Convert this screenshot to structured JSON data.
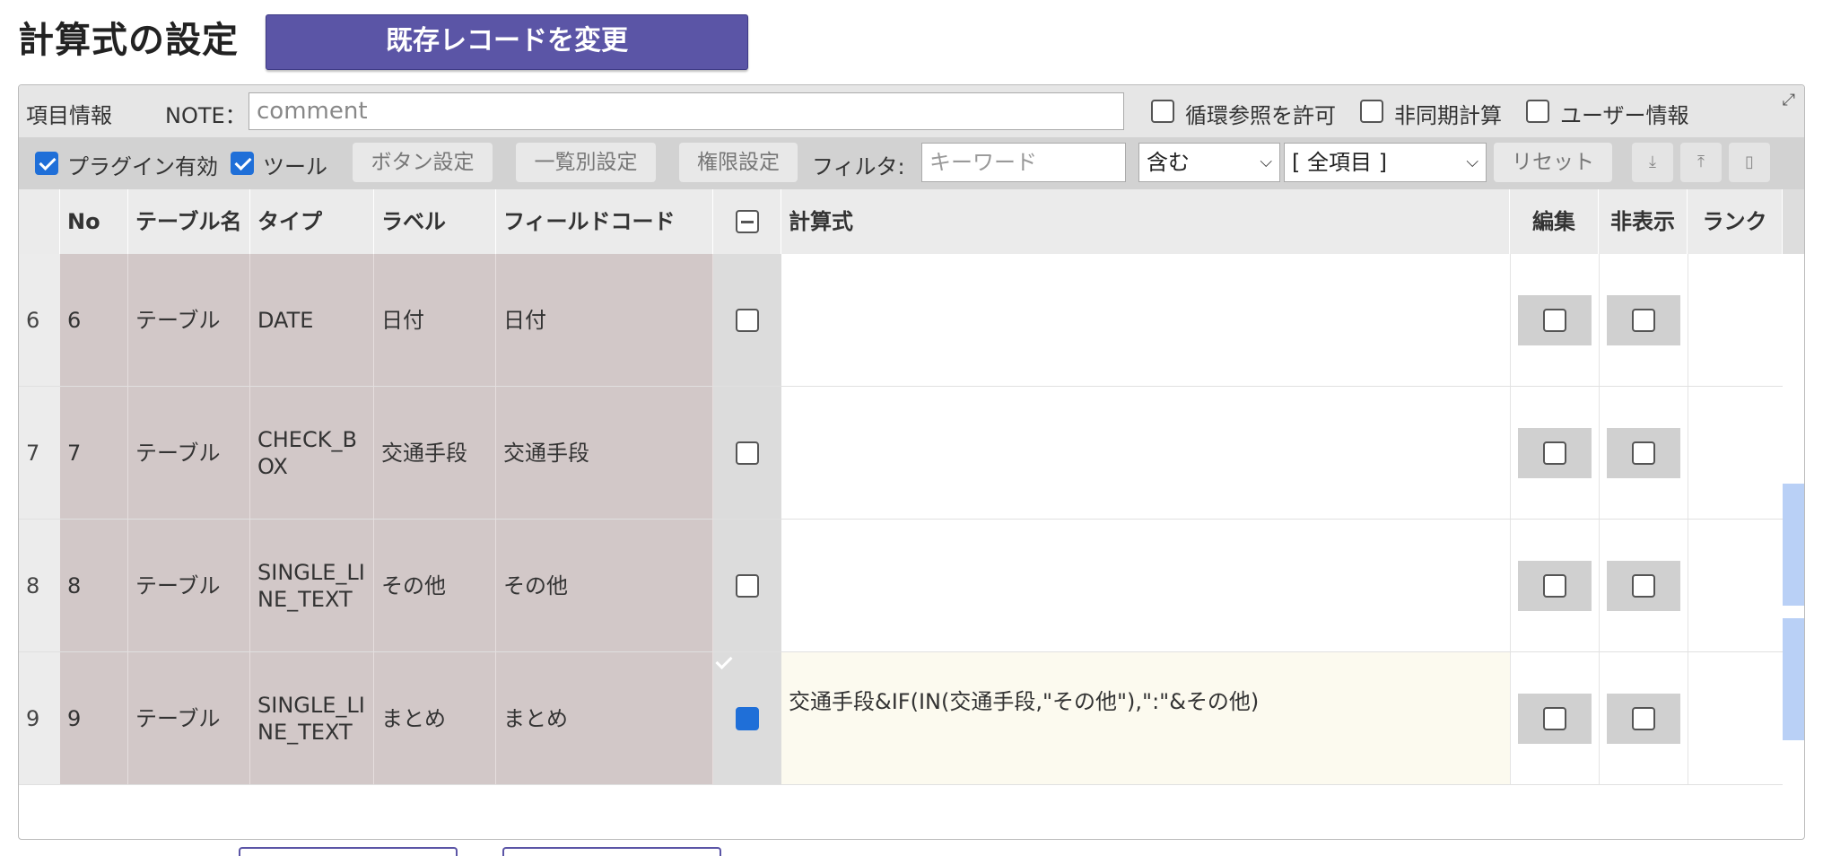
{
  "header": {
    "title": "計算式の設定",
    "change_button": "既存レコードを変更"
  },
  "info_bar": {
    "section_label": "項目情報",
    "note_label": "NOTE：",
    "note_value": "comment",
    "allow_circular_label": "循環参照を許可",
    "async_calc_label": "非同期計算",
    "user_info_label": "ユーザー情報"
  },
  "toolbar": {
    "plugin_enabled_label": "プラグイン有効",
    "plugin_enabled": true,
    "tool_label": "ツール",
    "tool_enabled": true,
    "button_settings": "ボタン設定",
    "list_settings": "一覧別設定",
    "permission_settings": "権限設定",
    "filter_label": "フィルタ:",
    "keyword_placeholder": "キーワード",
    "match_select": "含む",
    "field_select": "[ 全項目 ]",
    "reset_button": "リセット"
  },
  "table": {
    "headers": {
      "no": "No",
      "table_name": "テーブル名",
      "type": "タイプ",
      "label": "ラベル",
      "field_code": "フィールドコード",
      "formula": "計算式",
      "edit": "編集",
      "hidden": "非表示",
      "rank": "ランク"
    },
    "rows": [
      {
        "index": "6",
        "no": "6",
        "table_name": "テーブル",
        "type": "DATE",
        "label": "日付",
        "field_code": "日付",
        "checked": false,
        "formula": "",
        "edit": false,
        "hidden": false,
        "rank": ""
      },
      {
        "index": "7",
        "no": "7",
        "table_name": "テーブル",
        "type": "CHECK_BOX",
        "label": "交通手段",
        "field_code": "交通手段",
        "checked": false,
        "formula": "",
        "edit": false,
        "hidden": false,
        "rank": ""
      },
      {
        "index": "8",
        "no": "8",
        "table_name": "テーブル",
        "type": "SINGLE_LINE_TEXT",
        "label": "その他",
        "field_code": "その他",
        "checked": false,
        "formula": "",
        "edit": false,
        "hidden": false,
        "rank": ""
      },
      {
        "index": "9",
        "no": "9",
        "table_name": "テーブル",
        "type": "SINGLE_LINE_TEXT",
        "label": "まとめ",
        "field_code": "まとめ",
        "checked": true,
        "formula": "交通手段&IF(IN(交通手段,\"その他\"),\":\"&その他)",
        "edit": false,
        "hidden": false,
        "rank": ""
      }
    ]
  },
  "colors": {
    "accent": "#5b55a6",
    "readonly_cell": "#d2c8c8",
    "checkbox_checked": "#1f6fd8"
  }
}
